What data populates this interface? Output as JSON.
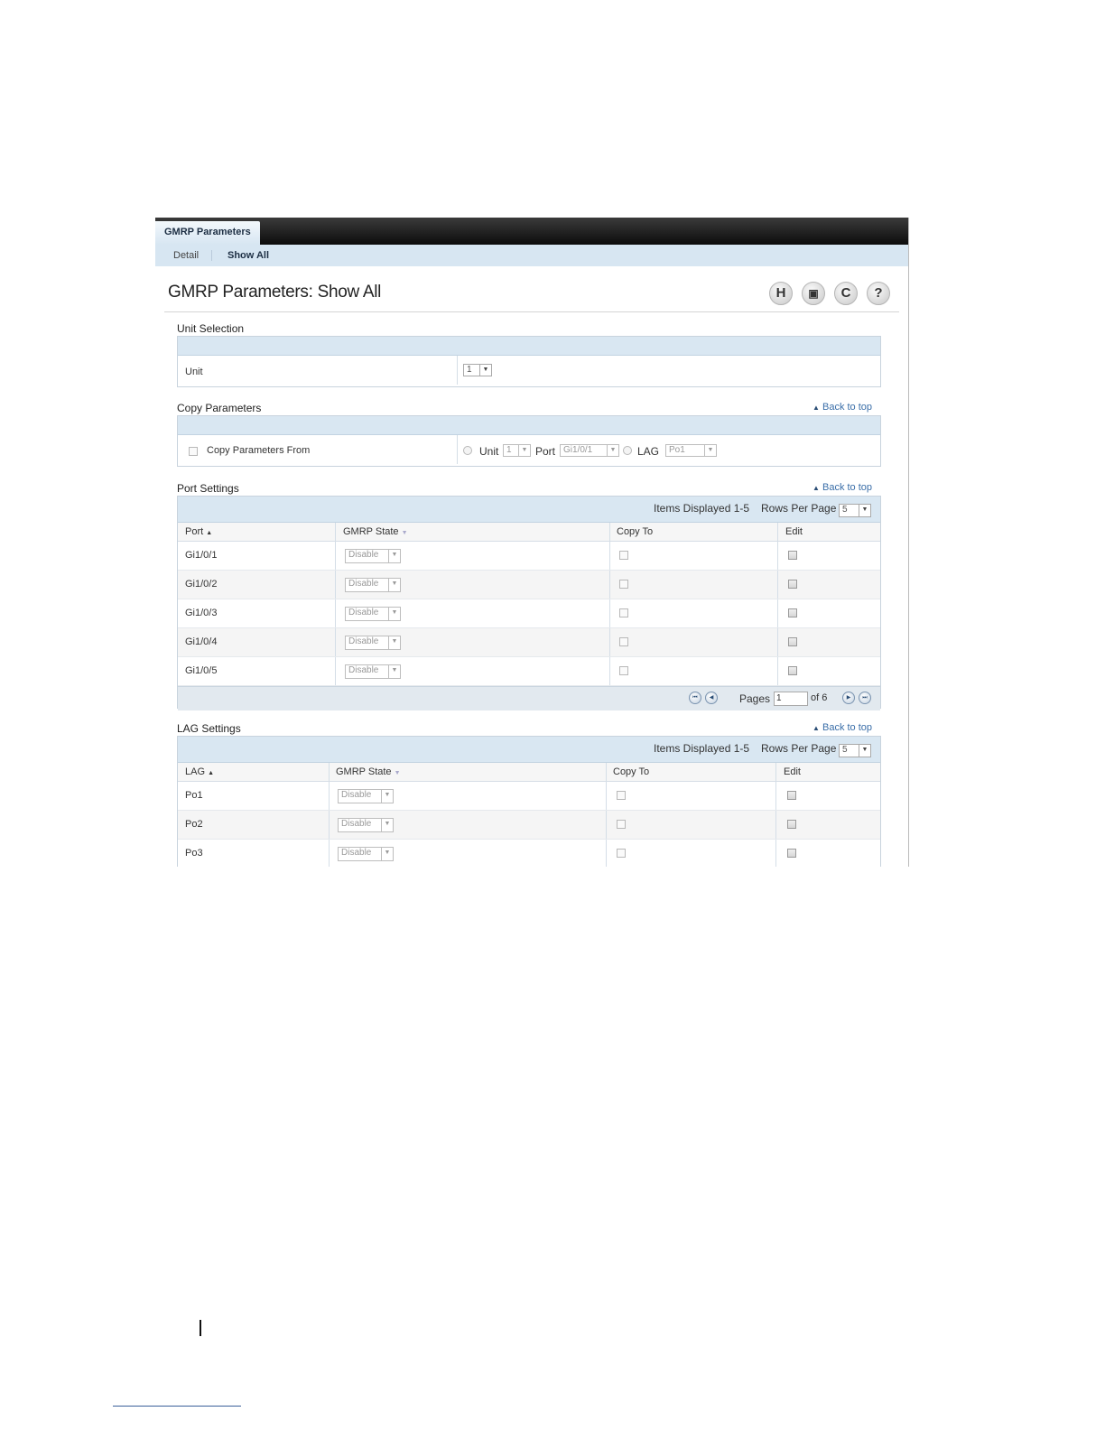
{
  "tabs": {
    "active": "GMRP Parameters"
  },
  "subnav": {
    "detail": "Detail",
    "show_all": "Show All"
  },
  "page": {
    "title": "GMRP Parameters: Show All"
  },
  "toolbar": {
    "save_icon": "H",
    "print_icon": "▣",
    "refresh_icon": "C",
    "help_icon": "?"
  },
  "back_to_top": "Back to top",
  "unit_selection": {
    "label": "Unit Selection",
    "row_label": "Unit",
    "value": "1"
  },
  "copy_parameters": {
    "label": "Copy Parameters",
    "checkbox_label": "Copy Parameters From",
    "unit_label": "Unit",
    "unit_value": "1",
    "port_label": "Port",
    "port_value": "Gi1/0/1",
    "lag_label": "LAG",
    "lag_value": "Po1"
  },
  "port_settings": {
    "label": "Port Settings",
    "items_displayed": "Items Displayed 1-5",
    "rows_per_page_label": "Rows Per Page",
    "rows_per_page": "5",
    "columns": {
      "port": "Port",
      "gmrp_state": "GMRP State",
      "copy_to": "Copy To",
      "edit": "Edit"
    },
    "rows": [
      {
        "port": "Gi1/0/1",
        "state": "Disable"
      },
      {
        "port": "Gi1/0/2",
        "state": "Disable"
      },
      {
        "port": "Gi1/0/3",
        "state": "Disable"
      },
      {
        "port": "Gi1/0/4",
        "state": "Disable"
      },
      {
        "port": "Gi1/0/5",
        "state": "Disable"
      }
    ],
    "pages_label": "Pages",
    "page_value": "1",
    "of_pages": "of 6"
  },
  "lag_settings": {
    "label": "LAG Settings",
    "items_displayed": "Items Displayed 1-5",
    "rows_per_page_label": "Rows Per Page",
    "rows_per_page": "5",
    "columns": {
      "lag": "LAG",
      "gmrp_state": "GMRP State",
      "copy_to": "Copy To",
      "edit": "Edit"
    },
    "rows": [
      {
        "lag": "Po1",
        "state": "Disable"
      },
      {
        "lag": "Po2",
        "state": "Disable"
      },
      {
        "lag": "Po3",
        "state": "Disable"
      }
    ]
  }
}
